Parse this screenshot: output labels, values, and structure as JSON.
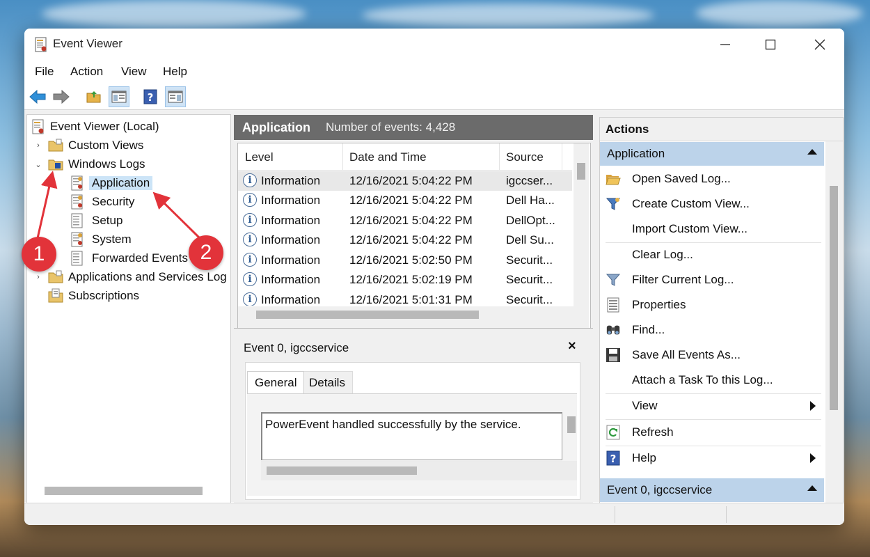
{
  "window": {
    "title": "Event Viewer",
    "controls": {
      "minimize": "minimize-icon",
      "maximize": "maximize-icon",
      "close": "close-icon"
    }
  },
  "menu": [
    "File",
    "Action",
    "View",
    "Help"
  ],
  "toolbar": [
    "back-arrow-icon",
    "forward-arrow-icon",
    "open-folder-icon",
    "show-hide-tree-icon",
    "help-icon",
    "show-hide-action-pane-icon"
  ],
  "tree": {
    "root": "Event Viewer (Local)",
    "custom_views": "Custom Views",
    "windows_logs": "Windows Logs",
    "logs": [
      "Application",
      "Security",
      "Setup",
      "System",
      "Forwarded Events"
    ],
    "apps_services": "Applications and Services Log",
    "subscriptions": "Subscriptions"
  },
  "middle": {
    "log_name": "Application",
    "event_count": "Number of events: 4,428",
    "columns": [
      "Level",
      "Date and Time",
      "Source"
    ],
    "rows": [
      {
        "level": "Information",
        "datetime": "12/16/2021 5:04:22 PM",
        "source": "igccser..."
      },
      {
        "level": "Information",
        "datetime": "12/16/2021 5:04:22 PM",
        "source": "Dell Ha..."
      },
      {
        "level": "Information",
        "datetime": "12/16/2021 5:04:22 PM",
        "source": "DellOpt..."
      },
      {
        "level": "Information",
        "datetime": "12/16/2021 5:04:22 PM",
        "source": "Dell Su..."
      },
      {
        "level": "Information",
        "datetime": "12/16/2021 5:02:50 PM",
        "source": "Securit..."
      },
      {
        "level": "Information",
        "datetime": "12/16/2021 5:02:19 PM",
        "source": "Securit..."
      },
      {
        "level": "Information",
        "datetime": "12/16/2021 5:01:31 PM",
        "source": "Securit..."
      }
    ]
  },
  "detail": {
    "title": "Event 0, igccservice",
    "close": "×",
    "tabs": [
      "General",
      "Details"
    ],
    "message": "PowerEvent handled successfully by the service."
  },
  "actions": {
    "title": "Actions",
    "section1": "Application",
    "items": [
      {
        "label": "Open Saved Log...",
        "icon": "open-folder-icon"
      },
      {
        "label": "Create Custom View...",
        "icon": "filter-new-icon"
      },
      {
        "label": "Import Custom View...",
        "icon": ""
      },
      {
        "label": "Clear Log...",
        "icon": ""
      },
      {
        "label": "Filter Current Log...",
        "icon": "filter-icon"
      },
      {
        "label": "Properties",
        "icon": "properties-icon"
      },
      {
        "label": "Find...",
        "icon": "binoculars-icon"
      },
      {
        "label": "Save All Events As...",
        "icon": "save-icon"
      },
      {
        "label": "Attach a Task To this Log...",
        "icon": ""
      },
      {
        "label": "View",
        "icon": ""
      },
      {
        "label": "Refresh",
        "icon": "refresh-icon"
      },
      {
        "label": "Help",
        "icon": "help-icon"
      }
    ],
    "section2": "Event 0, igccservice"
  },
  "annotations": [
    "1",
    "2"
  ],
  "colors": {
    "annotation": "#e2333a",
    "selection": "#cce4f7",
    "section_header": "#bcd3ea",
    "mid_header": "#6b6b6b"
  }
}
